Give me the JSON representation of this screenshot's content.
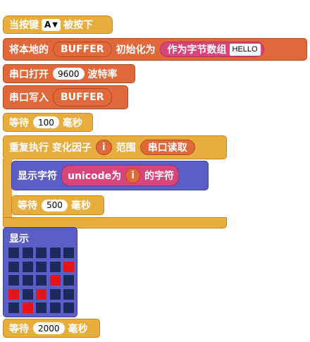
{
  "event_block": {
    "label": "当按键",
    "key": "A",
    "dropdown_icon": "▼",
    "suffix": "被按下"
  },
  "init_block": {
    "label": "将本地的",
    "var_name": "BUFFER",
    "mid": "初始化为",
    "array_label": "作为字节数组",
    "value": "HELLO"
  },
  "serial_open": {
    "label": "串口打开",
    "baud": "9600",
    "suffix": "波特率"
  },
  "serial_write": {
    "label": "串口写入",
    "arg": "BUFFER"
  },
  "wait1": {
    "label": "等待",
    "value": "100",
    "unit": "毫秒"
  },
  "repeat_block": {
    "label": "重复执行 变化因子",
    "var": "i",
    "range_label": "范围",
    "range_value": "串口读取"
  },
  "show_char": {
    "label": "显示字符",
    "expr": "unicode为",
    "var": "i",
    "suffix": "的字符"
  },
  "wait2": {
    "label": "等待",
    "value": "500",
    "unit": "毫秒"
  },
  "display_block": {
    "label": "显示",
    "grid": [
      [
        0,
        0,
        0,
        0,
        0
      ],
      [
        0,
        0,
        0,
        0,
        1
      ],
      [
        0,
        0,
        0,
        1,
        0
      ],
      [
        1,
        0,
        1,
        0,
        0
      ],
      [
        0,
        1,
        0,
        0,
        0
      ]
    ],
    "colors": {
      "on": "#e8141c",
      "off": "#1c2a5e"
    }
  },
  "wait3": {
    "label": "等待",
    "value": "2000",
    "unit": "毫秒"
  },
  "colors": {
    "event": "#e8ad3f",
    "variable": "#e0683a",
    "display": "#5b5ec7",
    "pink": "#d8457a"
  }
}
